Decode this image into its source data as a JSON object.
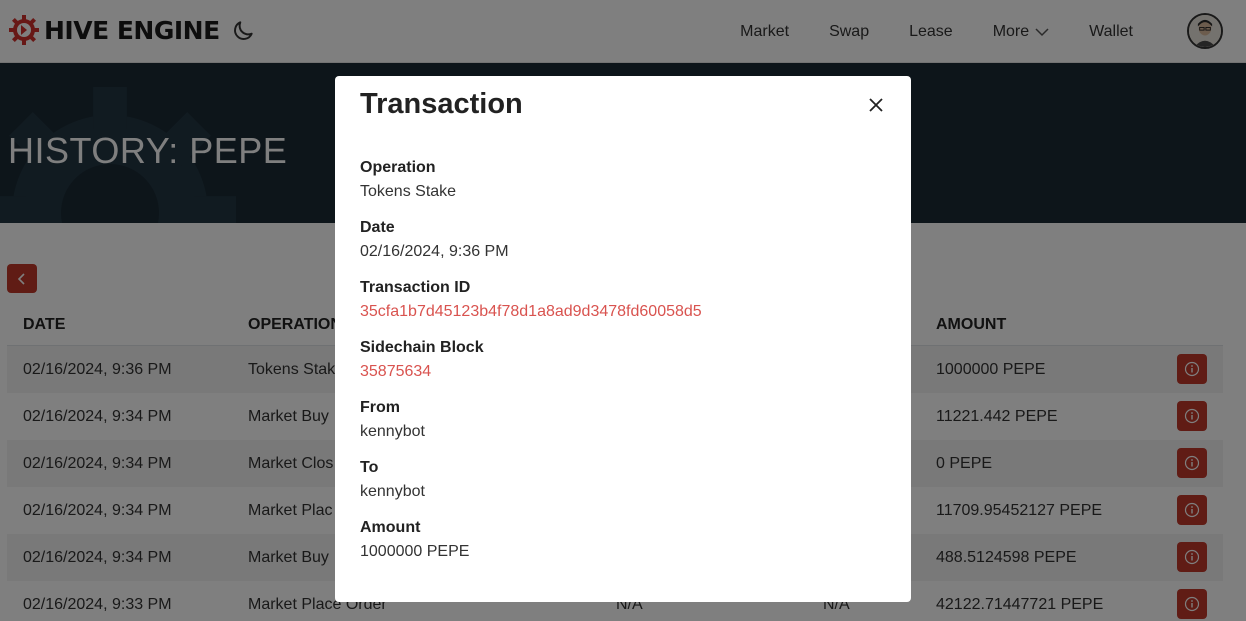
{
  "brand": {
    "name": "HIVE ENGINE",
    "accent": "#c0392b"
  },
  "nav": {
    "items": [
      "Market",
      "Swap",
      "Lease",
      "More",
      "Wallet"
    ]
  },
  "hero": {
    "title": "HISTORY: PEPE"
  },
  "table": {
    "headers": [
      "DATE",
      "OPERATION",
      "AMOUNT"
    ],
    "rows": [
      {
        "date": "02/16/2024, 9:36 PM",
        "operation": "Tokens Stak",
        "col3": "",
        "col4": "",
        "amount": "1000000 PEPE"
      },
      {
        "date": "02/16/2024, 9:34 PM",
        "operation": "Market Buy",
        "col3": "",
        "col4": "",
        "amount": "11221.442 PEPE"
      },
      {
        "date": "02/16/2024, 9:34 PM",
        "operation": "Market Clos",
        "col3": "",
        "col4": "",
        "amount": "0 PEPE"
      },
      {
        "date": "02/16/2024, 9:34 PM",
        "operation": "Market Plac",
        "col3": "",
        "col4": "",
        "amount": "11709.95452127 PEPE"
      },
      {
        "date": "02/16/2024, 9:34 PM",
        "operation": "Market Buy",
        "col3": "",
        "col4": "",
        "amount": "488.5124598 PEPE"
      },
      {
        "date": "02/16/2024, 9:33 PM",
        "operation": "Market Place Order",
        "col3": "N/A",
        "col4": "N/A",
        "amount": "42122.71447721 PEPE"
      }
    ]
  },
  "modal": {
    "title": "Transaction",
    "fields": [
      {
        "label": "Operation",
        "value": "Tokens Stake",
        "link": false
      },
      {
        "label": "Date",
        "value": "02/16/2024, 9:36 PM",
        "link": false
      },
      {
        "label": "Transaction ID",
        "value": "35cfa1b7d45123b4f78d1a8ad9d3478fd60058d5",
        "link": true
      },
      {
        "label": "Sidechain Block",
        "value": "35875634",
        "link": true
      },
      {
        "label": "From",
        "value": "kennybot",
        "link": false
      },
      {
        "label": "To",
        "value": "kennybot",
        "link": false
      },
      {
        "label": "Amount",
        "value": "1000000 PEPE",
        "link": false
      }
    ]
  }
}
